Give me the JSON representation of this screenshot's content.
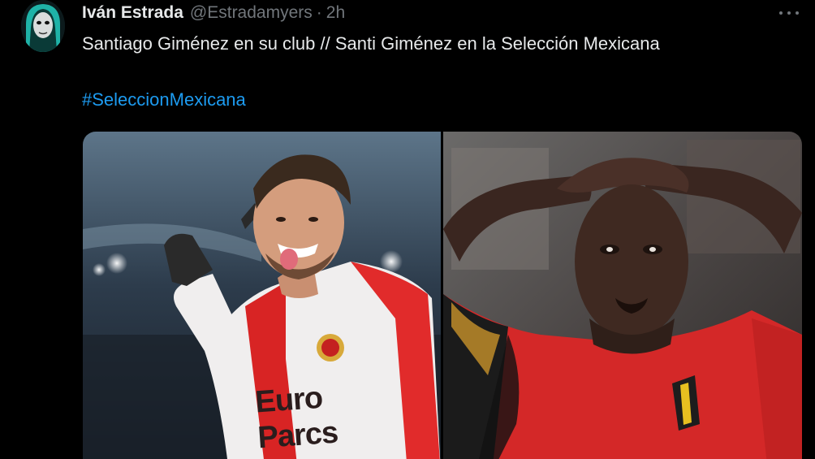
{
  "author": {
    "display_name": "Iván Estrada",
    "handle": "@Estradamyers",
    "separator": "·",
    "time": "2h",
    "avatar_icon": "masked-face-avatar"
  },
  "tweet": {
    "text": "Santiago Giménez en su club // Santi Giménez en la Selección Mexicana",
    "hashtag": "#SeleccionMexicana"
  },
  "media": {
    "left_photo": {
      "shirt_sponsor_line1": "Euro",
      "shirt_sponsor_line2": "Parcs"
    }
  },
  "colors": {
    "background": "#000000",
    "text": "#e7e9ea",
    "secondary": "#71767b",
    "link": "#1d9bf0"
  }
}
